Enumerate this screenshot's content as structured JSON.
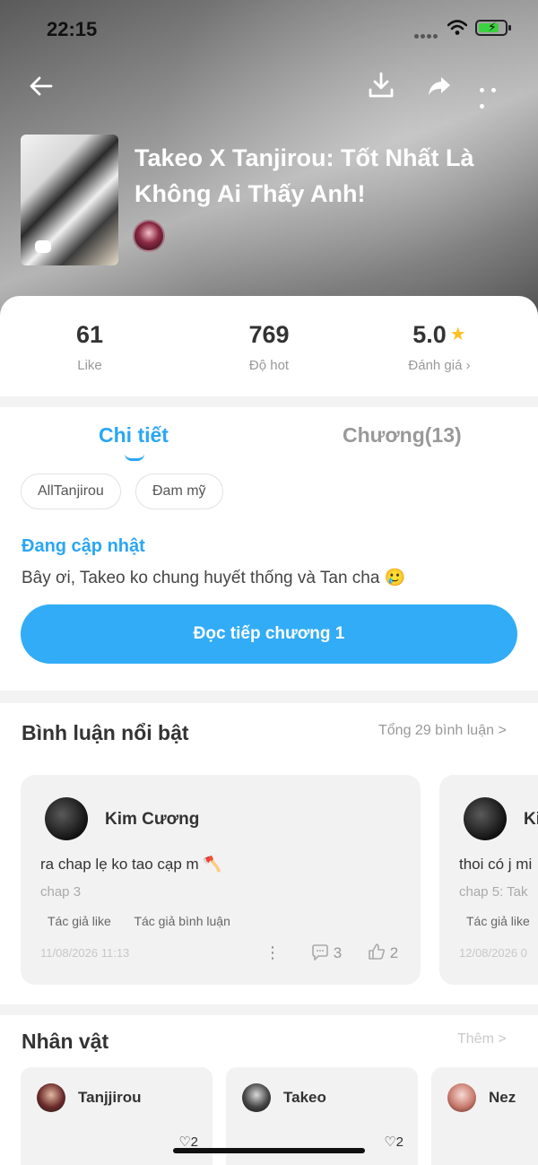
{
  "status_bar": {
    "time": "22:15"
  },
  "header": {
    "book_title": "Takeo X Tanjirou: Tốt Nhất Là Không Ai Thấy Anh!",
    "icons": [
      "back-arrow-icon",
      "download-icon",
      "share-icon",
      "more-icon"
    ]
  },
  "stats": [
    {
      "value": "61",
      "label": "Like"
    },
    {
      "value": "769",
      "label": "Độ hot"
    },
    {
      "value": "5.0",
      "label": "Đánh giá ›"
    }
  ],
  "tabs": {
    "detail": "Chi tiết",
    "chapters": "Chương(13)"
  },
  "tags": [
    "AllTanjirou",
    "Đam mỹ"
  ],
  "update_status": "Đang cập nhật",
  "description": "Bây ơi, Takeo ko chung huyết thống và Tan cha 🥲",
  "read_button": "Đọc tiếp chương 1",
  "comments": {
    "title": "Bình luận nổi bật",
    "total_link": "Tổng 29 bình luận >",
    "items": [
      {
        "name": "Kim Cương",
        "text": "ra chap lẹ ko tao cạp m 🪓",
        "chapter": "chap 3",
        "tag1": "Tác giả like",
        "tag2": "Tác giả bình luận",
        "date": "11/08/2026 11:13",
        "replies": "3",
        "likes": "2"
      },
      {
        "name": "Ki",
        "text": "thoi có j mi",
        "chapter": "chap 5: Tak",
        "tag1": "Tác giả like",
        "date": "12/08/2026 0"
      }
    ]
  },
  "characters": {
    "title": "Nhân vật",
    "more": "Thêm >",
    "items": [
      {
        "name": "Tanjjirou",
        "likes": "2"
      },
      {
        "name": "Takeo",
        "likes": "2"
      },
      {
        "name": "Nez"
      }
    ]
  },
  "colors": {
    "accent": "#2aa6f5",
    "button": "#32acf6",
    "star": "#ffbf1f"
  }
}
